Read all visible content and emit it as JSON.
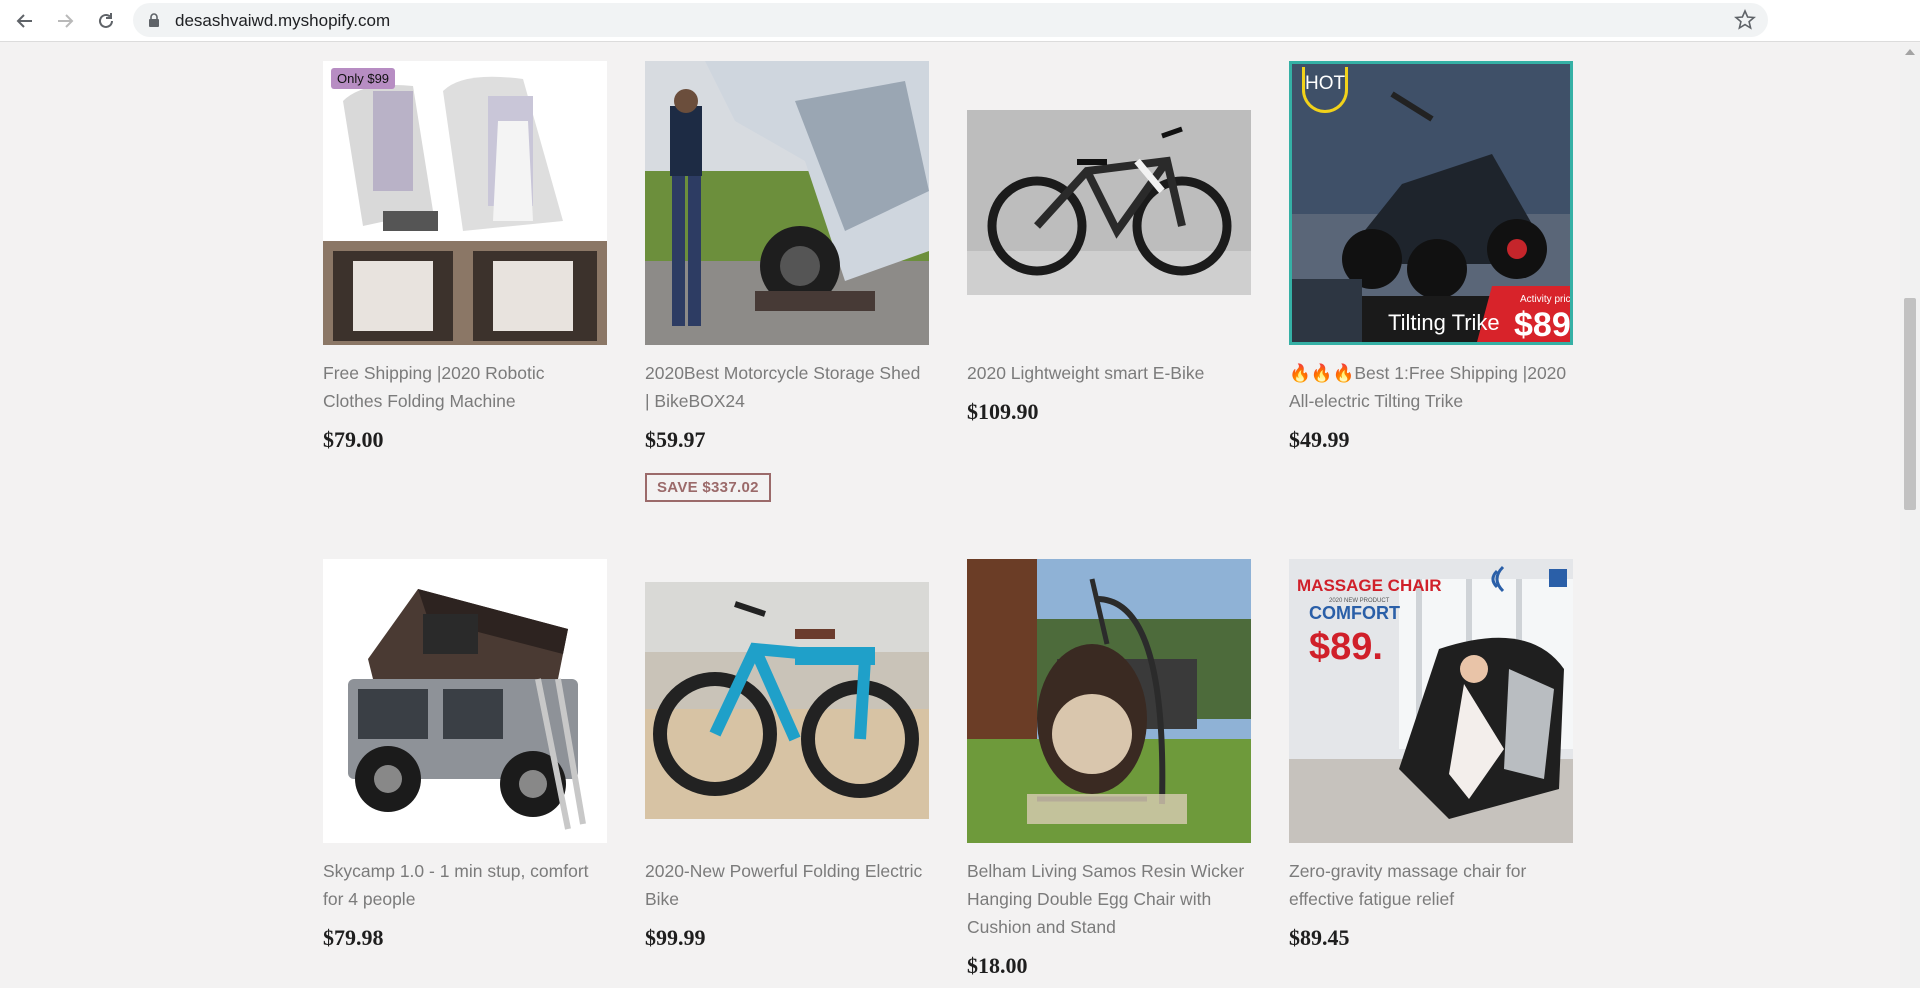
{
  "browser": {
    "url": "desashvaiwd.myshopify.com",
    "icons": [
      "back-icon",
      "forward-icon",
      "reload-icon",
      "lock-icon",
      "star-icon"
    ]
  },
  "products": [
    {
      "title": "Free Shipping |2020 Robotic Clothes Folding Machine",
      "price": "$79.00",
      "image_label": "Only $99"
    },
    {
      "title": "2020Best Motorcycle Storage Shed | BikeBOX24",
      "price": "$59.97",
      "save": "SAVE $337.02"
    },
    {
      "title": "2020 Lightweight smart E-Bike",
      "price": "$109.90"
    },
    {
      "title": "🔥🔥🔥Best 1:Free Shipping |2020 All-electric Tilting Trike",
      "price": "$49.99",
      "image_badge": "HOT",
      "image_caption": "Tilting Trike",
      "image_price_label": "Activity price",
      "image_price": "$89"
    },
    {
      "title": "Skycamp 1.0 - 1 min stup, comfort for 4 people",
      "price": "$79.98"
    },
    {
      "title": "2020-New Powerful Folding Electric Bike",
      "price": "$99.99"
    },
    {
      "title": "Belham Living Samos Resin Wicker Hanging Double Egg Chair with Cushion and Stand",
      "price": "$18.00"
    },
    {
      "title": "Zero-gravity massage chair for effective fatigue relief",
      "price": "$89.45",
      "image_heading": "MASSAGE CHAIR",
      "image_sub": "2020 NEW PRODUCT",
      "image_word": "COMFORT",
      "image_price": "$89."
    }
  ]
}
